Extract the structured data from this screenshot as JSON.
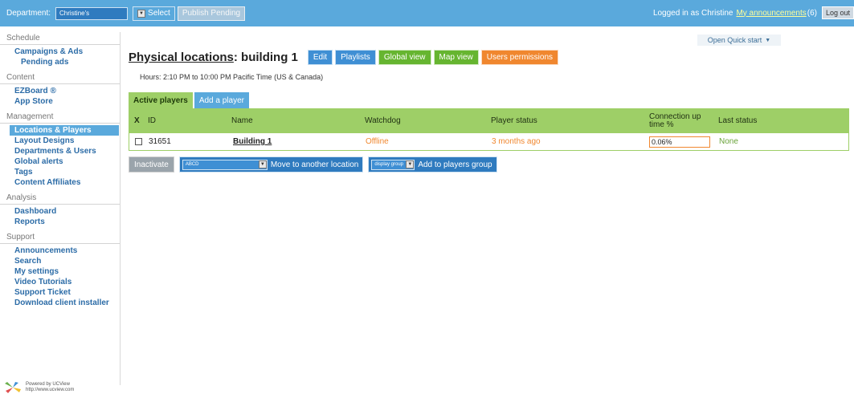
{
  "topbar": {
    "department_label": "Department:",
    "department_value": "Christine's",
    "select_label": "Select",
    "publish_label": "Publish Pending",
    "logged_in_text": "Logged in as Christine",
    "announcements_link": "My announcements",
    "announcements_count": "(6)",
    "logout_label": "Log out"
  },
  "sidebar": {
    "schedule_header": "Schedule",
    "campaigns": "Campaigns & Ads",
    "pending_ads": "Pending ads",
    "content_header": "Content",
    "ezboard": "EZBoard ®",
    "app_store": "App Store",
    "management_header": "Management",
    "locations": "Locations & Players",
    "layout_designs": "Layout Designs",
    "departments": "Departments & Users",
    "global_alerts": "Global alerts",
    "tags": "Tags",
    "content_affiliates": "Content Affiliates",
    "analysis_header": "Analysis",
    "dashboard": "Dashboard",
    "reports": "Reports",
    "support_header": "Support",
    "announcements": "Announcements",
    "search": "Search",
    "my_settings": "My settings",
    "video_tutorials": "Video Tutorials",
    "support_ticket": "Support Ticket",
    "download_installer": "Download client installer"
  },
  "footer": {
    "powered_by": "Powered by UCView",
    "url": "http://www.ucview.com"
  },
  "main": {
    "title_link": "Physical locations",
    "title_rest": ": building 1",
    "hours": "Hours: 2:10 PM to 10:00 PM Pacific Time (US & Canada)",
    "buttons": {
      "edit": "Edit",
      "playlists": "Playlists",
      "global_view": "Global view",
      "map_view": "Map view",
      "users_permissions": "Users permissions"
    },
    "open_quick_start": "Open Quick start"
  },
  "tabs": {
    "active_players": "Active players",
    "add_player": "Add a player"
  },
  "table": {
    "headers": {
      "x": "X",
      "id": "ID",
      "name": "Name",
      "watchdog": "Watchdog",
      "player_status": "Player status",
      "connection": "Connection up time %",
      "last_status": "Last status"
    },
    "rows": [
      {
        "id": "31651",
        "name": "Building 1",
        "watchdog": "Offline",
        "player_status": "3 months ago",
        "connection": "0.06%",
        "last_status": "None"
      }
    ]
  },
  "actions": {
    "inactivate": "Inactivate",
    "location_select": "ABCD",
    "move_label": "Move to another location",
    "group_select": "display group",
    "add_group_label": "Add to players group"
  },
  "colors": {
    "topbar": "#5aa9dc",
    "table_header": "#9ecf67",
    "button_blue": "#3f8fd4",
    "button_green": "#66b530",
    "button_orange": "#f0872f",
    "link_blue": "#2c6ca7"
  }
}
